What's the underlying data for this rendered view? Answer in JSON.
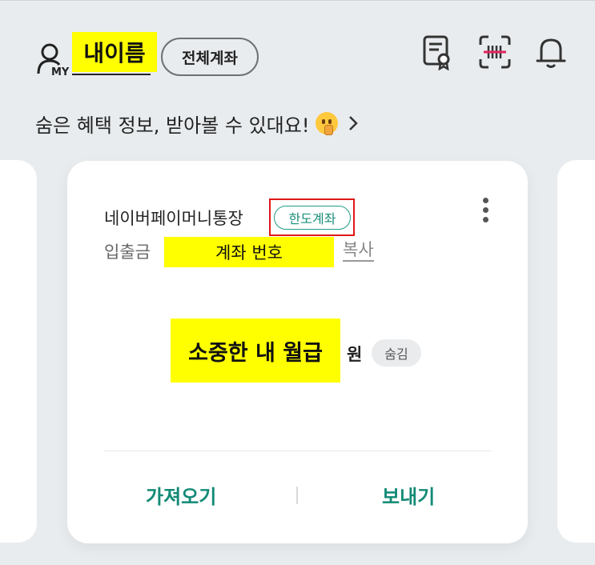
{
  "header": {
    "user_name": "내이름",
    "my_label": "MY",
    "all_accounts_label": "전체계좌",
    "icons": [
      "certificate-icon",
      "barcode-scan-icon",
      "bell-icon"
    ]
  },
  "promo": {
    "text": "숨은 혜택 정보, 받아볼 수 있대요!",
    "emoji": "shushing-face"
  },
  "card": {
    "account_name": "네이버페이머니통장",
    "limit_badge": "한도계좌",
    "io_label": "입출금",
    "account_number": "계좌 번호",
    "copy_label": "복사",
    "balance": "소중한 내 월급",
    "currency": "원",
    "hide_label": "숨김",
    "import_label": "가져오기",
    "send_label": "보내기"
  },
  "colors": {
    "accent": "#128a76",
    "highlight": "#ffff00",
    "annotation_outline": "#e01818"
  }
}
